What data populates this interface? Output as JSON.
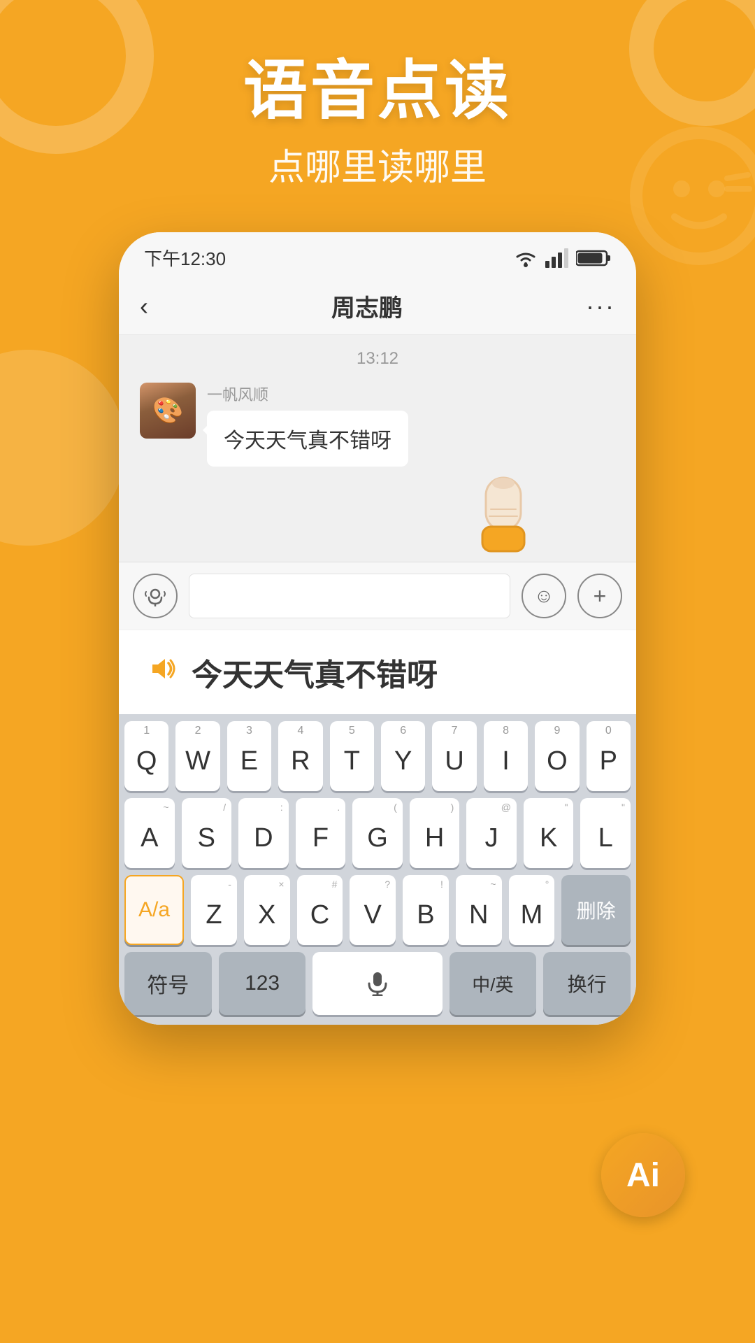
{
  "background_color": "#F5A623",
  "header": {
    "main_title": "语音点读",
    "sub_title": "点哪里读哪里"
  },
  "phone": {
    "status_bar": {
      "time": "下午12:30",
      "wifi": "wifi",
      "signal": "signal",
      "battery": "battery"
    },
    "chat_header": {
      "back_label": "‹",
      "title": "周志鹏",
      "more_label": "···"
    },
    "timestamp": "13:12",
    "message": {
      "sender_name": "一帆风顺",
      "text": "今天天气真不错呀"
    },
    "input_bar": {
      "emoji_label": "☺",
      "plus_label": "+"
    },
    "reading_banner": {
      "text": "今天天气真不错呀"
    }
  },
  "keyboard": {
    "row1": {
      "keys": [
        {
          "num": "1",
          "letter": "Q"
        },
        {
          "num": "2",
          "letter": "W"
        },
        {
          "num": "3",
          "letter": "E"
        },
        {
          "num": "4",
          "letter": "R"
        },
        {
          "num": "5",
          "letter": "T"
        },
        {
          "num": "6",
          "letter": "Y"
        },
        {
          "num": "7",
          "letter": "U"
        },
        {
          "num": "8",
          "letter": "I"
        },
        {
          "num": "9",
          "letter": "O"
        },
        {
          "num": "0",
          "letter": "P"
        }
      ]
    },
    "row2": {
      "keys": [
        {
          "sub": "~",
          "letter": "A"
        },
        {
          "sub": "/",
          "letter": "S"
        },
        {
          "sub": ":",
          "letter": "D"
        },
        {
          "sub": ".",
          "letter": "F"
        },
        {
          "sub": "(",
          "letter": "G"
        },
        {
          "sub": ")",
          "letter": "H"
        },
        {
          "sub": "@",
          "letter": "J"
        },
        {
          "sub": "\"",
          "letter": "K"
        },
        {
          "sub": "\"",
          "letter": "L"
        }
      ]
    },
    "row3": {
      "shift_label": "A/a",
      "keys": [
        {
          "sub": "-",
          "letter": "Z"
        },
        {
          "sub": "×",
          "letter": "X"
        },
        {
          "sub": "#",
          "letter": "C"
        },
        {
          "sub": "?",
          "letter": "V"
        },
        {
          "sub": "!",
          "letter": "B"
        },
        {
          "sub": "~",
          "letter": "N"
        },
        {
          "sub": "°",
          "letter": "M"
        }
      ],
      "delete_label": "删除"
    },
    "bottom_row": {
      "symbol_label": "符号",
      "num_label": "123",
      "mic_label": "🎤",
      "lang_label": "中/英",
      "enter_label": "换行"
    }
  },
  "ai_badge": {
    "label": "Ai"
  }
}
